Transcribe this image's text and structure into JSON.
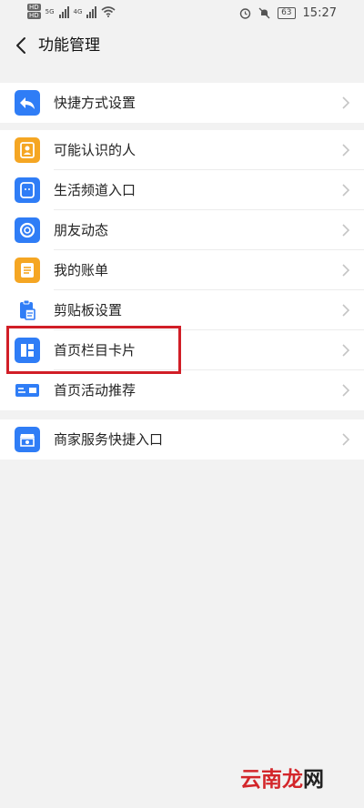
{
  "status_bar": {
    "sim_labels": [
      "HD",
      "HD"
    ],
    "net_labels": [
      "5G",
      "4G"
    ],
    "battery": "63",
    "time": "15:27"
  },
  "header": {
    "title": "功能管理",
    "back_icon": "chevron-left-icon"
  },
  "groups": [
    {
      "items": [
        {
          "label": "快捷方式设置",
          "icon": "shortcut-reply-icon",
          "color": "#2f7df6"
        }
      ]
    },
    {
      "items": [
        {
          "label": "可能认识的人",
          "icon": "contact-card-icon",
          "color": "#f5a623"
        },
        {
          "label": "生活频道入口",
          "icon": "life-channel-icon",
          "color": "#2f7df6"
        },
        {
          "label": "朋友动态",
          "icon": "moments-icon",
          "color": "#2f7df6"
        },
        {
          "label": "我的账单",
          "icon": "bill-icon",
          "color": "#f5a623"
        },
        {
          "label": "剪贴板设置",
          "icon": "clipboard-icon",
          "color": "#2f7df6"
        },
        {
          "label": "首页栏目卡片",
          "icon": "cards-layout-icon",
          "color": "#2f7df6"
        },
        {
          "label": "首页活动推荐",
          "icon": "activity-card-icon",
          "color": "#2f7df6"
        }
      ]
    },
    {
      "items": [
        {
          "label": "商家服务快捷入口",
          "icon": "merchant-store-icon",
          "color": "#2f7df6"
        }
      ]
    }
  ],
  "colors": {
    "accent_blue": "#2f7df6",
    "accent_orange": "#f5a623",
    "highlight_red": "#d11e27"
  },
  "watermark": {
    "brand": "云南龙",
    "suffix": "网"
  }
}
